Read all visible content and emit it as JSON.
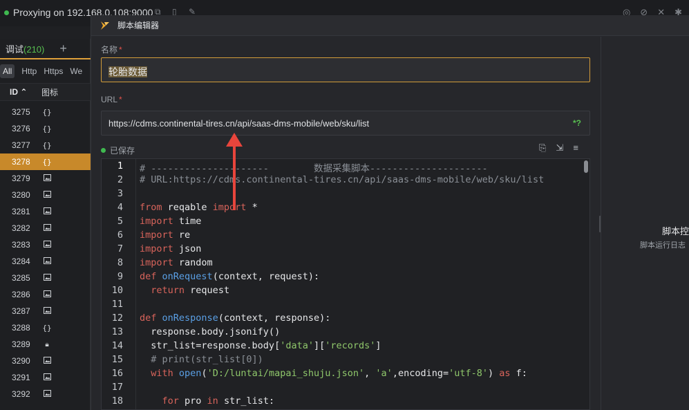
{
  "topbar": {
    "proxy_text": "Proxying on 192.168.0.108:9000"
  },
  "left_panel": {
    "tab_label": "调试",
    "tab_count": "(210)",
    "plus": "+",
    "filters": [
      "All",
      "Http",
      "Https",
      "We"
    ],
    "columns": {
      "id": "ID",
      "icon": "图标"
    },
    "rows": [
      {
        "id": "3275",
        "icon": "{}"
      },
      {
        "id": "3276",
        "icon": "{}"
      },
      {
        "id": "3277",
        "icon": "{}"
      },
      {
        "id": "3278",
        "icon": "{}",
        "selected": true
      },
      {
        "id": "3279",
        "icon": "img"
      },
      {
        "id": "3280",
        "icon": "img"
      },
      {
        "id": "3281",
        "icon": "img"
      },
      {
        "id": "3282",
        "icon": "img"
      },
      {
        "id": "3283",
        "icon": "img"
      },
      {
        "id": "3284",
        "icon": "img"
      },
      {
        "id": "3285",
        "icon": "img"
      },
      {
        "id": "3286",
        "icon": "img"
      },
      {
        "id": "3287",
        "icon": "img"
      },
      {
        "id": "3288",
        "icon": "{}"
      },
      {
        "id": "3289",
        "icon": "lock"
      },
      {
        "id": "3290",
        "icon": "img"
      },
      {
        "id": "3291",
        "icon": "img"
      },
      {
        "id": "3292",
        "icon": "img"
      }
    ]
  },
  "dialog": {
    "title": "脚本编辑器",
    "name_label": "名称",
    "name_value": "轮胎数据",
    "url_label": "URL",
    "url_value": "https://cdms.continental-tires.cn/api/saas-dms-mobile/web/sku/list",
    "url_regex_badge": "*?",
    "saved_label": "已保存",
    "right_title": "脚本控",
    "right_subtitle": "脚本运行日志",
    "code_lines": [
      "# ---------------------        数据采集脚本---------------------",
      "# URL:https://cdms.continental-tires.cn/api/saas-dms-mobile/web/sku/list",
      "",
      "from reqable import *",
      "import time",
      "import re",
      "import json",
      "import random",
      "def onRequest(context, request):",
      "  return request",
      "",
      "def onResponse(context, response):",
      "  response.body.jsonify()",
      "  str_list=response.body['data']['records']",
      "  # print(str_list[0])",
      "  with open('D:/luntai/mapai_shuju.json', 'a',encoding='utf-8') as f:",
      "",
      "    for pro in str_list:"
    ],
    "line_numbers": [
      "1",
      "2",
      "3",
      "4",
      "5",
      "6",
      "7",
      "8",
      "9",
      "10",
      "11",
      "12",
      "13",
      "14",
      "15",
      "16",
      "17",
      "18"
    ]
  },
  "colors": {
    "accent": "#d39d3a",
    "selected_row": "#c8892a",
    "ok_green": "#3fb950",
    "annotation_red": "#e8453c"
  }
}
